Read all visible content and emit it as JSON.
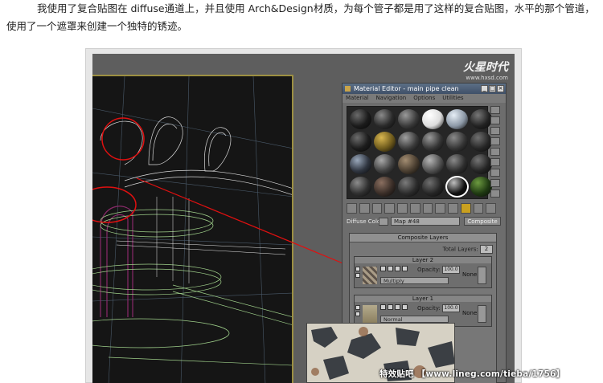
{
  "article": {
    "paragraph": "我使用了复合贴图在 diffuse通道上，并且使用 Arch&Design材质，为每个管子都是用了这样的复合贴图，水平的那个管道，使用了一个遮罩来创建一个独特的锈迹。"
  },
  "brand": {
    "logo": "火星时代",
    "url": "www.hxsd.com"
  },
  "material_editor": {
    "title": "Material Editor - main pipe clean",
    "window_buttons": [
      "_",
      "□",
      "×"
    ],
    "menu": [
      "Material",
      "Navigation",
      "Options",
      "Utilities"
    ],
    "diffuse_label": "Diffuse Color:",
    "map_name": "Map #48",
    "map_type": "Composite",
    "rollout_title": "Composite Layers",
    "total_layers_label": "Total Layers:",
    "total_layers_value": "2",
    "layers": [
      {
        "title": "Layer 2",
        "opacity_label": "Opacity:",
        "opacity": "100.0",
        "blend": "Multiply",
        "mask": "None"
      },
      {
        "title": "Layer 1",
        "opacity_label": "Opacity:",
        "opacity": "100.0",
        "blend": "Normal",
        "mask": "None"
      }
    ],
    "sample_slots": [
      {
        "c": "#1b1b1b",
        "hi": "#6a6a6a"
      },
      {
        "c": "#2a2a2a",
        "hi": "#8a8a8a"
      },
      {
        "c": "#3a3a3a",
        "hi": "#9a9a9a"
      },
      {
        "c": "#dddddd",
        "hi": "#ffffff"
      },
      {
        "c": "#8c98a6",
        "hi": "#e6eef6"
      },
      {
        "c": "#222222",
        "hi": "#777777"
      },
      {
        "c": "#1c1c1c",
        "hi": "#6d6d6d"
      },
      {
        "c": "#6e5a1c",
        "hi": "#d8b650"
      },
      {
        "c": "#3a3a3a",
        "hi": "#a0a0a0"
      },
      {
        "c": "#353535",
        "hi": "#9a9a9a"
      },
      {
        "c": "#353535",
        "hi": "#8a8a8a"
      },
      {
        "c": "#262626",
        "hi": "#707070"
      },
      {
        "c": "#2f3540",
        "hi": "#9aa8bb"
      },
      {
        "c": "#404040",
        "hi": "#a9a9a9"
      },
      {
        "c": "#4a3e30",
        "hi": "#a38d72"
      },
      {
        "c": "#505050",
        "hi": "#b5b5b5"
      },
      {
        "c": "#2e2e2e",
        "hi": "#8a8a8a"
      },
      {
        "c": "#242424",
        "hi": "#747474"
      },
      {
        "c": "#303030",
        "hi": "#8c8c8c"
      },
      {
        "c": "#3a2e28",
        "hi": "#8a6f60"
      },
      {
        "c": "#2c2c2c",
        "hi": "#7b7b7b"
      },
      {
        "c": "#262626",
        "hi": "#6f6f6f"
      },
      {
        "c": "#101010",
        "hi": "#bfbfbf",
        "sel": true
      },
      {
        "c": "#1f3a12",
        "hi": "#6c9a40"
      }
    ]
  },
  "watermark": "特效贴吧 【www.lineg.com/tieba/1756】"
}
